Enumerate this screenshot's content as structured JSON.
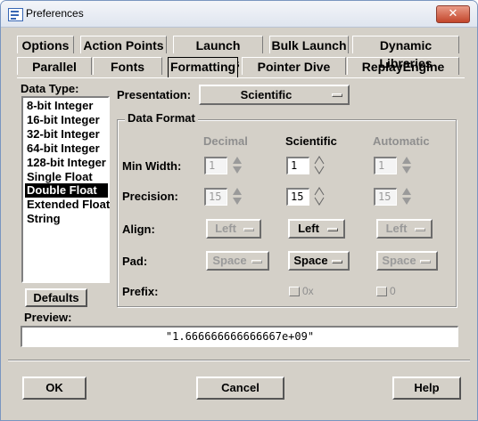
{
  "window": {
    "title": "Preferences",
    "close_symbol": "✕"
  },
  "tabs_row1": [
    "Options",
    "Action Points",
    "Launch Strings",
    "Bulk Launch",
    "Dynamic Libraries"
  ],
  "tabs_row2": [
    "Parallel",
    "Fonts",
    "Formatting",
    "Pointer Dive",
    "ReplayEngine"
  ],
  "active_tab": "Formatting",
  "data_type": {
    "label": "Data Type:",
    "items": [
      "8-bit Integer",
      "16-bit Integer",
      "32-bit Integer",
      "64-bit Integer",
      "128-bit Integer",
      "Single Float",
      "Double Float",
      "Extended Float",
      "String"
    ],
    "selected": "Double Float"
  },
  "defaults_button": "Defaults",
  "presentation": {
    "label": "Presentation:",
    "value": "Scientific"
  },
  "data_format": {
    "label": "Data Format",
    "columns": [
      "Decimal",
      "Scientific",
      "Automatic"
    ],
    "rows": {
      "min_width": {
        "label": "Min Width:",
        "values": [
          "1",
          "1",
          "1"
        ]
      },
      "precision": {
        "label": "Precision:",
        "values": [
          "15",
          "15",
          "15"
        ]
      },
      "align": {
        "label": "Align:",
        "values": [
          "Left",
          "Left",
          "Left"
        ]
      },
      "pad": {
        "label": "Pad:",
        "values": [
          "Space",
          "Space",
          "Space"
        ]
      },
      "prefix": {
        "label": "Prefix:",
        "values": [
          "0x",
          "0"
        ]
      }
    }
  },
  "preview": {
    "label": "Preview:",
    "value": "\"1.666666666666667e+09\""
  },
  "buttons": {
    "ok": "OK",
    "cancel": "Cancel",
    "help": "Help"
  }
}
